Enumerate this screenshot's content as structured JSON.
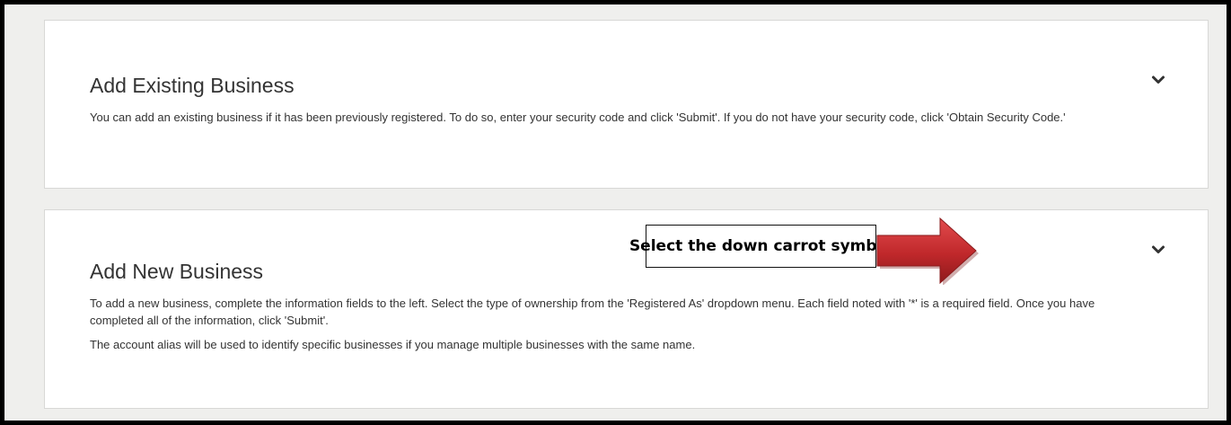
{
  "panels": [
    {
      "title": "Add Existing Business",
      "paragraphs": [
        "You can add an existing business if it has been previously registered. To do so, enter your security code and click 'Submit'. If you do not have your security code, click 'Obtain Security Code.'"
      ],
      "expand_icon": "chevron-down-icon"
    },
    {
      "title": "Add New Business",
      "paragraphs": [
        "To add a new business, complete the information fields to the left. Select the type of ownership from the 'Registered As' dropdown menu. Each field noted with '*' is a required field. Once you have completed all of the information, click 'Submit'.",
        "The account alias will be used to identify specific businesses if you manage multiple businesses with the same name."
      ],
      "expand_icon": "chevron-down-icon"
    }
  ],
  "annotation": {
    "callout_text": "Select the down carrot symbol",
    "arrow_icon": "red-arrow-icon",
    "arrow_color": "#c0282b"
  },
  "colors": {
    "background": "#efefed",
    "panel_background": "#ffffff",
    "panel_border": "#d8d8d6",
    "text": "#333333"
  }
}
